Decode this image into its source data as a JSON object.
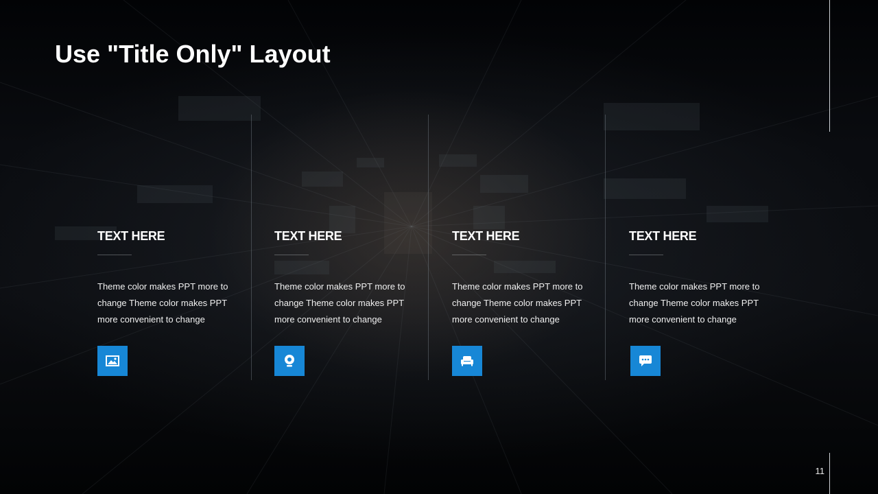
{
  "slide": {
    "title": "Use \"Title Only\" Layout",
    "page_number": "11"
  },
  "theme": {
    "accent": "#1787d6",
    "background": "#07090c"
  },
  "cards": [
    {
      "heading": "TEXT HERE",
      "body": "Theme  color makes PPT more to change Theme  color makes PPT more convenient  to change",
      "icon": "image-icon"
    },
    {
      "heading": "TEXT HERE",
      "body": "Theme  color makes PPT more to change Theme  color makes PPT more convenient  to change",
      "icon": "location-pin-icon"
    },
    {
      "heading": "TEXT HERE",
      "body": "Theme  color makes PPT more to change Theme  color makes PPT more convenient  to change",
      "icon": "sofa-icon"
    },
    {
      "heading": "TEXT HERE",
      "body": "Theme  color makes PPT more to change Theme  color makes PPT more convenient  to change",
      "icon": "chat-bubble-icon"
    }
  ]
}
